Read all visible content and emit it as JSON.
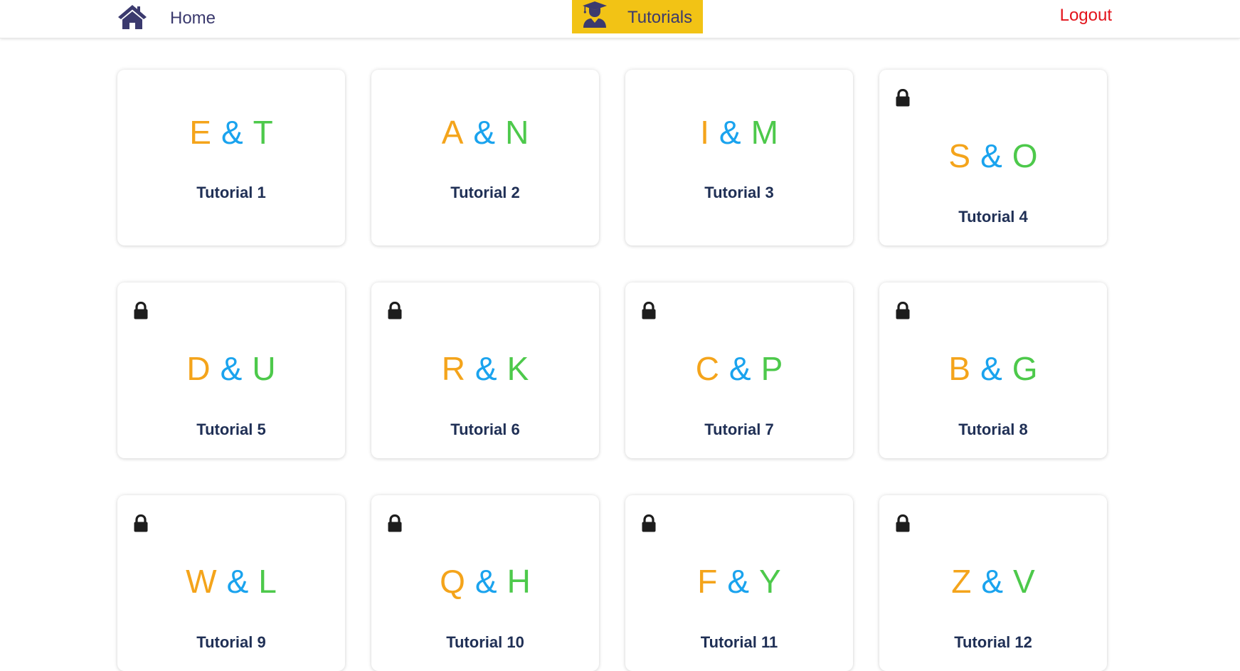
{
  "nav": {
    "home_label": "Home",
    "home_icon": "home-icon",
    "tutorials_label": "Tutorials",
    "tutorials_icon": "graduate-icon",
    "logout_label": "Logout",
    "colors": {
      "nav_text": "#3b3a6e",
      "active_bg": "#f2c315",
      "logout": "#e3131b"
    }
  },
  "colors": {
    "first_letter": "#f4a41b",
    "ampersand": "#1aa3ee",
    "second_letter": "#4dc94b",
    "title": "#1f2f55",
    "lock": "#1d1d1d"
  },
  "tutorials": [
    {
      "a": "E",
      "amp": "&",
      "b": "T",
      "title": "Tutorial 1",
      "locked": false
    },
    {
      "a": "A",
      "amp": "&",
      "b": "N",
      "title": "Tutorial 2",
      "locked": false
    },
    {
      "a": "I",
      "amp": "&",
      "b": "M",
      "title": "Tutorial 3",
      "locked": false
    },
    {
      "a": "S",
      "amp": "&",
      "b": "O",
      "title": "Tutorial 4",
      "locked": true
    },
    {
      "a": "D",
      "amp": "&",
      "b": "U",
      "title": "Tutorial 5",
      "locked": true
    },
    {
      "a": "R",
      "amp": "&",
      "b": "K",
      "title": "Tutorial 6",
      "locked": true
    },
    {
      "a": "C",
      "amp": "&",
      "b": "P",
      "title": "Tutorial 7",
      "locked": true
    },
    {
      "a": "B",
      "amp": "&",
      "b": "G",
      "title": "Tutorial 8",
      "locked": true
    },
    {
      "a": "W",
      "amp": "&",
      "b": "L",
      "title": "Tutorial 9",
      "locked": true
    },
    {
      "a": "Q",
      "amp": "&",
      "b": "H",
      "title": "Tutorial 10",
      "locked": true
    },
    {
      "a": "F",
      "amp": "&",
      "b": "Y",
      "title": "Tutorial 11",
      "locked": true
    },
    {
      "a": "Z",
      "amp": "&",
      "b": "V",
      "title": "Tutorial 12",
      "locked": true
    }
  ]
}
